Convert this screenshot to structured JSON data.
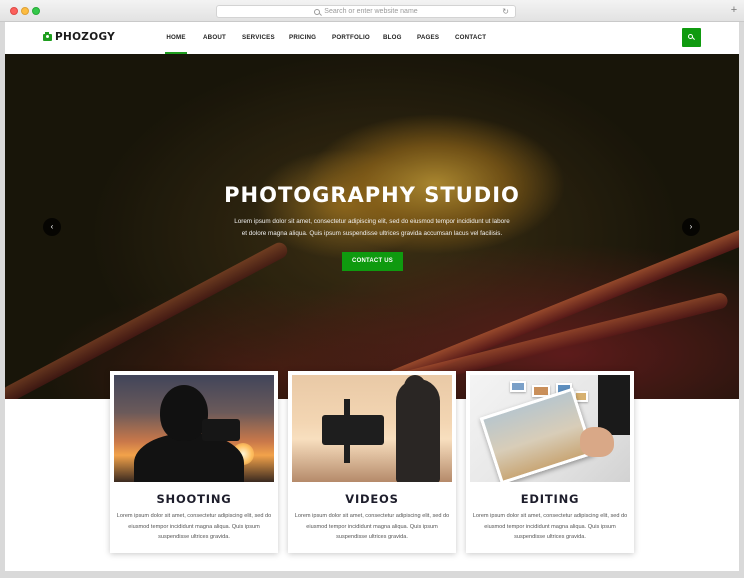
{
  "browser": {
    "url_placeholder": "Search or enter website name",
    "reload_icon": "reload-icon",
    "new_tab_label": "+"
  },
  "site": {
    "logo": "PHOZOGY",
    "accent_color": "#0f9a0f",
    "nav": [
      {
        "label": "HOME",
        "active": true
      },
      {
        "label": "ABOUT",
        "active": false
      },
      {
        "label": "SERVICES",
        "active": false
      },
      {
        "label": "PRICING",
        "active": false
      },
      {
        "label": "PORTFOLIO",
        "active": false
      },
      {
        "label": "BLOG",
        "active": false
      },
      {
        "label": "PAGES",
        "active": false
      },
      {
        "label": "CONTACT",
        "active": false
      }
    ],
    "search_icon": "search-icon"
  },
  "hero": {
    "title": "PHOTOGRAPHY STUDIO",
    "text": "Lorem ipsum dolor sit amet, consectetur adipiscing elit, sed do eiusmod tempor incididunt ut labore et dolore magna aliqua. Quis ipsum suspendisse ultrices gravida accumsan lacus vel facilisis.",
    "cta": "CONTACT US",
    "prev": "‹",
    "next": "›"
  },
  "services": [
    {
      "title": "SHOOTING",
      "text": "Lorem ipsum dolor sit amet, consectetur adipiscing elit, sed do eiusmod tempor incididunt magna aliqua. Quis ipsum suspendisse ultrices gravida."
    },
    {
      "title": "VIDEOS",
      "text": "Lorem ipsum dolor sit amet, consectetur adipiscing elit, sed do eiusmod tempor incididunt magna aliqua. Quis ipsum suspendisse ultrices gravida."
    },
    {
      "title": "EDITING",
      "text": "Lorem ipsum dolor sit amet, consectetur adipiscing elit, sed do eiusmod tempor incididunt magna aliqua. Quis ipsum suspendisse ultrices gravida."
    }
  ]
}
